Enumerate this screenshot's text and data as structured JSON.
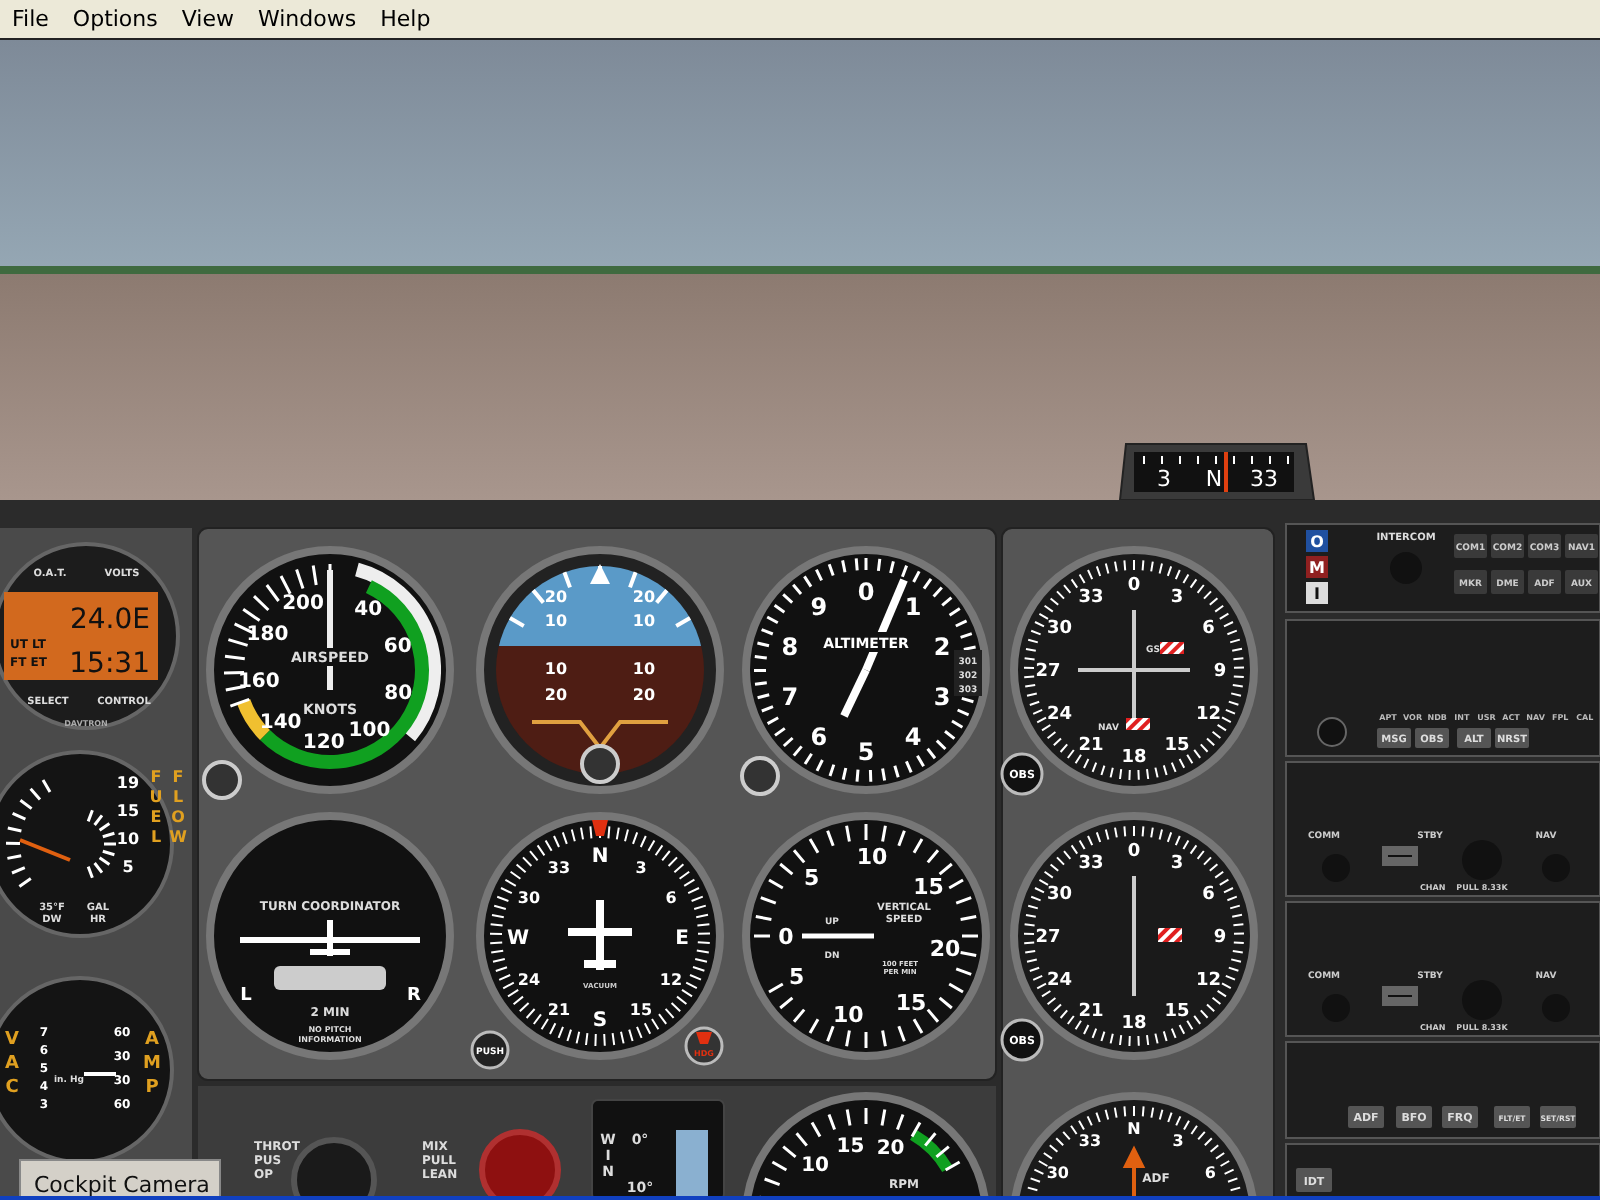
{
  "menu": [
    {
      "label": "File"
    },
    {
      "label": "Options"
    },
    {
      "label": "View"
    },
    {
      "label": "Windows"
    },
    {
      "label": "Help"
    }
  ],
  "compass": [
    "3",
    "N",
    "33"
  ],
  "clock": {
    "labels_top": [
      "O.A.T.",
      "VOLTS"
    ],
    "value": "24.0E",
    "time": "15:31",
    "modes": [
      "UT LT",
      "FT ET"
    ],
    "buttons": [
      "SELECT",
      "CONTROL"
    ],
    "brand": "DAVTRON"
  },
  "fuel_flow": {
    "scale": [
      "19",
      "15",
      "10",
      "5"
    ],
    "word_1": "FUEL",
    "word_2": "FLOW",
    "temp": "35°F",
    "temp_2": "DW",
    "unit": "GAL",
    "unit_2": "HR"
  },
  "vac_amp": {
    "vac": "VAC",
    "amp": "AMP",
    "vac_scale": [
      "7",
      "6",
      "5",
      "4",
      "3"
    ],
    "amp_scale": [
      "60",
      "30",
      "30",
      "60"
    ],
    "unit": "in. Hg"
  },
  "airspeed": {
    "scale": [
      "40",
      "60",
      "80",
      "100",
      "120",
      "140",
      "160",
      "180",
      "200"
    ],
    "title": "AIRSPEED",
    "unit": "KNOTS"
  },
  "attitude": {
    "upper": [
      "20",
      "20",
      "10",
      "10"
    ],
    "lower": [
      "10",
      "10",
      "20",
      "20"
    ]
  },
  "altimeter": {
    "scale": [
      "0",
      "1",
      "2",
      "3",
      "4",
      "5",
      "6",
      "7",
      "8",
      "9"
    ],
    "title": "ALTIMETER",
    "kollsman": [
      "301",
      "302",
      "303"
    ]
  },
  "turn_coordinator": {
    "title": "TURN COORDINATOR",
    "left": "L",
    "right": "R",
    "time": "2 MIN",
    "note": [
      "NO PITCH",
      "INFORMATION"
    ]
  },
  "heading": {
    "scale": [
      "N",
      "3",
      "6",
      "E",
      "12",
      "15",
      "S",
      "21",
      "24",
      "W",
      "30",
      "33"
    ],
    "card": "VACUUM",
    "push": "PUSH",
    "hdg": "HDG"
  },
  "vsi": {
    "scale": [
      "0",
      "5",
      "10",
      "15",
      "20",
      "15",
      "10",
      "5"
    ],
    "title": [
      "VERTICAL",
      "SPEED"
    ],
    "up": "UP",
    "dn": "DN",
    "unit": [
      "100 FEET",
      "PER MIN"
    ]
  },
  "vors": [
    {
      "kind": "nav_gs",
      "scale": [
        "0",
        "3",
        "6",
        "9",
        "12",
        "15",
        "18",
        "21",
        "24",
        "27",
        "30",
        "33"
      ],
      "flags": [
        "GS",
        "NAV"
      ],
      "obs": "OBS"
    },
    {
      "kind": "nav",
      "scale": [
        "0",
        "3",
        "6",
        "9",
        "12",
        "15",
        "18",
        "21",
        "24",
        "27",
        "30",
        "33"
      ],
      "obs": "OBS"
    }
  ],
  "rpm": {
    "scale": [
      "10",
      "15",
      "20"
    ],
    "title": "RPM"
  },
  "adf": {
    "scale": [
      "30",
      "33",
      "N",
      "3",
      "6"
    ],
    "title": "ADF"
  },
  "throttle": [
    "THROT",
    "PUS",
    "OP"
  ],
  "mixture": [
    "MIX",
    "PULL",
    "LEAN"
  ],
  "flaps": {
    "letters": [
      "W",
      "I",
      "N"
    ],
    "marks": [
      "0°",
      "10°"
    ]
  },
  "camera_window": {
    "title": "Cockpit Camera"
  },
  "audio_panel": {
    "markers": [
      "O",
      "M",
      "I"
    ],
    "title": "INTERCOM",
    "buttons": [
      "COM1",
      "COM2",
      "COM3",
      "NAV1",
      "MKR",
      "DME",
      "ADF",
      "AUX"
    ]
  },
  "gps": {
    "modes": [
      "APT",
      "VOR",
      "NDB",
      "INT",
      "USR",
      "ACT",
      "NAV",
      "FPL",
      "CAL"
    ],
    "buttons": [
      "MSG",
      "OBS",
      "ALT",
      "NRST"
    ]
  },
  "nav_coms": [
    {
      "labels": [
        "COMM",
        "STBY",
        "NAV"
      ],
      "knob_label": "PULL 8.33K",
      "chan": "CHAN"
    },
    {
      "labels": [
        "COMM",
        "STBY",
        "NAV"
      ],
      "knob_label": "PULL 8.33K",
      "chan": "CHAN"
    }
  ],
  "adf_radio": {
    "buttons": [
      "ADF",
      "BFO",
      "FRQ",
      "FLT/ET",
      "SET/RST"
    ]
  },
  "transponder": {
    "buttons": [
      "IDT"
    ]
  }
}
